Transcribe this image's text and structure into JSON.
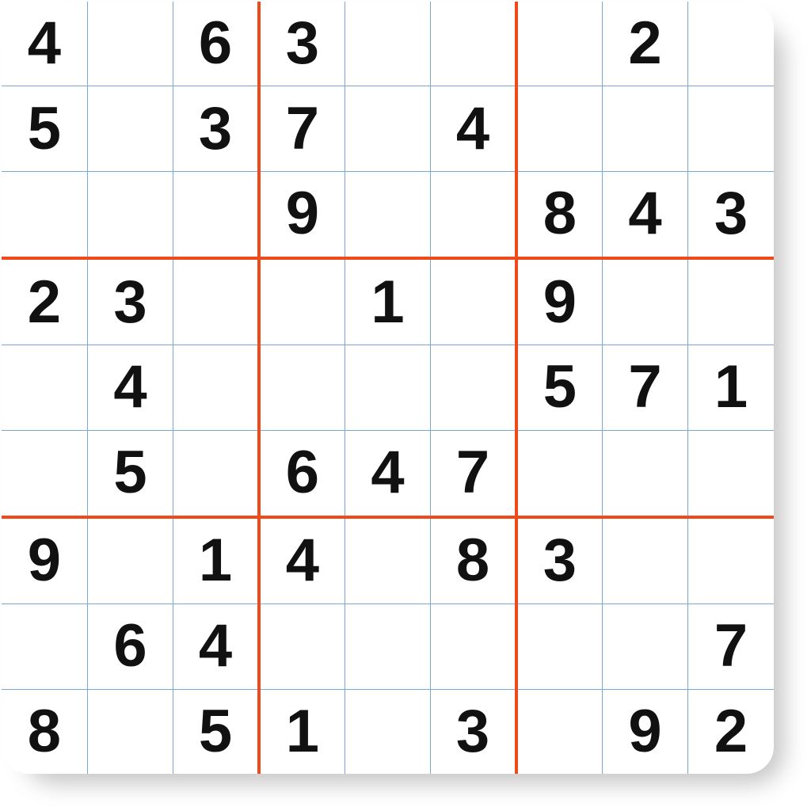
{
  "grid": [
    [
      "4",
      "",
      "6",
      "3",
      "",
      "",
      "",
      "2",
      ""
    ],
    [
      "5",
      "",
      "3",
      "7",
      "",
      "4",
      "",
      "",
      ""
    ],
    [
      "",
      "",
      "",
      "9",
      "",
      "",
      "8",
      "4",
      "3"
    ],
    [
      "2",
      "3",
      "",
      "",
      "1",
      "",
      "9",
      "",
      ""
    ],
    [
      "",
      "4",
      "",
      "",
      "",
      "",
      "5",
      "7",
      "1"
    ],
    [
      "",
      "5",
      "",
      "6",
      "4",
      "7",
      "",
      "",
      ""
    ],
    [
      "9",
      "",
      "1",
      "4",
      "",
      "8",
      "3",
      "",
      ""
    ],
    [
      "",
      "6",
      "4",
      "",
      "",
      "",
      "",
      "",
      "7"
    ],
    [
      "8",
      "",
      "5",
      "1",
      "",
      "3",
      "",
      "9",
      "2"
    ]
  ],
  "colors": {
    "cell_line": "#7aa8d6",
    "box_line": "#f04a1a",
    "digit": "#111111",
    "bg": "#ffffff"
  }
}
